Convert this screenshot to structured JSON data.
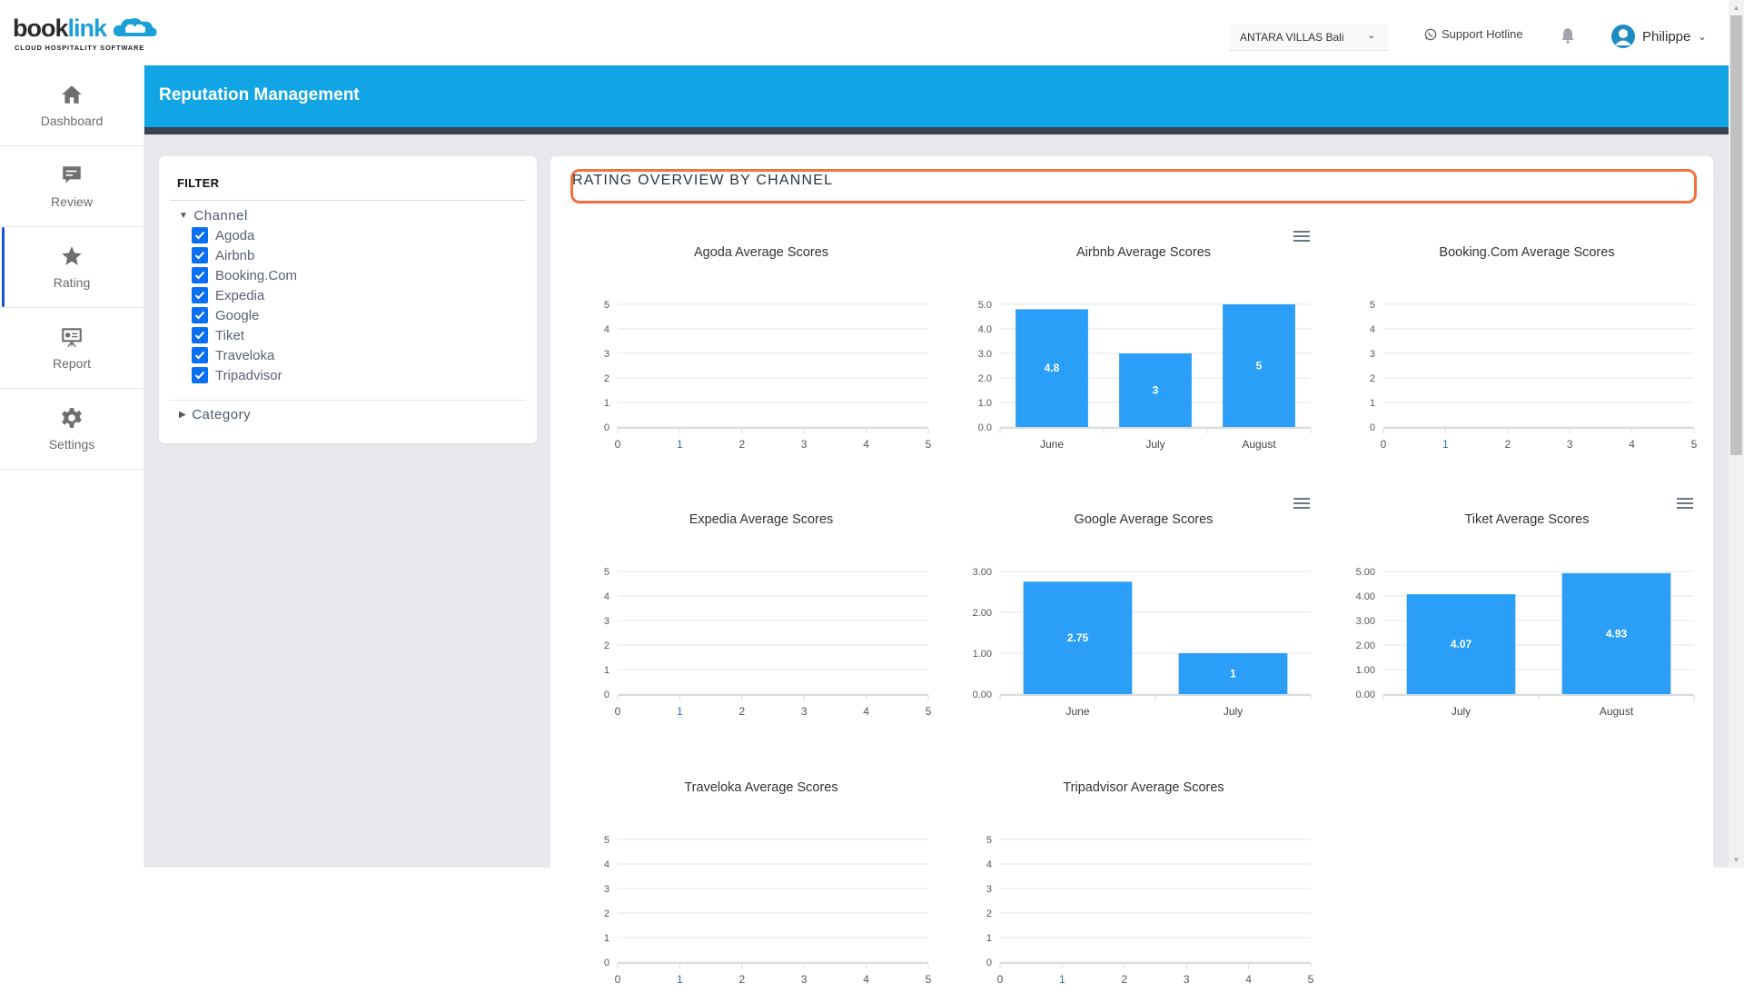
{
  "brand": {
    "logo_word_1": "book",
    "logo_word_2": "link",
    "tagline": "CLOUD HOSPITALITY SOFTWARE",
    "accent_color": "#12a5e5",
    "bar_color": "#2b9ff7",
    "highlight_color": "#f5703c"
  },
  "header": {
    "hotel_select_value": "ANTARA VILLAS Bali",
    "support_label": "Support Hotline",
    "user_name": "Philippe"
  },
  "sidebar": {
    "items": [
      {
        "label": "Dashboard",
        "icon": "home-icon",
        "active": false
      },
      {
        "label": "Review",
        "icon": "comment-icon",
        "active": false
      },
      {
        "label": "Rating",
        "icon": "star-icon",
        "active": true
      },
      {
        "label": "Report",
        "icon": "presentation-icon",
        "active": false
      },
      {
        "label": "Settings",
        "icon": "gear-icon",
        "active": false
      }
    ]
  },
  "page": {
    "title": "Reputation Management"
  },
  "filter": {
    "title": "FILTER",
    "channel_label": "Channel",
    "channel_expanded": true,
    "channels": [
      {
        "label": "Agoda",
        "checked": true
      },
      {
        "label": "Airbnb",
        "checked": true
      },
      {
        "label": "Booking.Com",
        "checked": true
      },
      {
        "label": "Expedia",
        "checked": true
      },
      {
        "label": "Google",
        "checked": true
      },
      {
        "label": "Tiket",
        "checked": true
      },
      {
        "label": "Traveloka",
        "checked": true
      },
      {
        "label": "Tripadvisor",
        "checked": true
      }
    ],
    "category_label": "Category",
    "category_expanded": false
  },
  "overview": {
    "title": "RATING OVERVIEW BY CHANNEL"
  },
  "chart_data": [
    {
      "type": "bar",
      "title": "Agoda Average Scores",
      "categories": [],
      "values": [],
      "empty": true,
      "yticks": [
        "0",
        "1",
        "2",
        "3",
        "4",
        "5"
      ],
      "xticks": [
        "0",
        "1",
        "2",
        "3",
        "4",
        "5"
      ],
      "ylim": [
        0,
        5
      ],
      "grid": true,
      "has_menu": false
    },
    {
      "type": "bar",
      "title": "Airbnb Average Scores",
      "categories": [
        "June",
        "July",
        "August"
      ],
      "values": [
        4.8,
        3,
        5
      ],
      "data_labels": [
        "4.8",
        "3",
        "5"
      ],
      "yticks": [
        "0.0",
        "1.0",
        "2.0",
        "3.0",
        "4.0",
        "5.0"
      ],
      "ylim": [
        0,
        5
      ],
      "grid": true,
      "has_menu": true
    },
    {
      "type": "bar",
      "title": "Booking.Com Average Scores",
      "categories": [],
      "values": [],
      "empty": true,
      "yticks": [
        "0",
        "1",
        "2",
        "3",
        "4",
        "5"
      ],
      "xticks": [
        "0",
        "1",
        "2",
        "3",
        "4",
        "5"
      ],
      "ylim": [
        0,
        5
      ],
      "grid": true,
      "has_menu": false
    },
    {
      "type": "bar",
      "title": "Expedia Average Scores",
      "categories": [],
      "values": [],
      "empty": true,
      "yticks": [
        "0",
        "1",
        "2",
        "3",
        "4",
        "5"
      ],
      "xticks": [
        "0",
        "1",
        "2",
        "3",
        "4",
        "5"
      ],
      "ylim": [
        0,
        5
      ],
      "grid": true,
      "has_menu": false
    },
    {
      "type": "bar",
      "title": "Google Average Scores",
      "categories": [
        "June",
        "July"
      ],
      "values": [
        2.75,
        1
      ],
      "data_labels": [
        "2.75",
        "1"
      ],
      "yticks": [
        "0.00",
        "1.00",
        "2.00",
        "3.00"
      ],
      "ylim": [
        0,
        3
      ],
      "grid": true,
      "has_menu": true
    },
    {
      "type": "bar",
      "title": "Tiket Average Scores",
      "categories": [
        "July",
        "August"
      ],
      "values": [
        4.07,
        4.93
      ],
      "data_labels": [
        "4.07",
        "4.93"
      ],
      "yticks": [
        "0.00",
        "1.00",
        "2.00",
        "3.00",
        "4.00",
        "5.00"
      ],
      "ylim": [
        0,
        5
      ],
      "grid": true,
      "has_menu": true
    },
    {
      "type": "bar",
      "title": "Traveloka Average Scores",
      "categories": [],
      "values": [],
      "empty": true,
      "yticks": [
        "0",
        "1",
        "2",
        "3",
        "4",
        "5"
      ],
      "xticks": [
        "0",
        "1",
        "2",
        "3",
        "4",
        "5"
      ],
      "ylim": [
        0,
        5
      ],
      "grid": true,
      "has_menu": false
    },
    {
      "type": "bar",
      "title": "Tripadvisor Average Scores",
      "categories": [],
      "values": [],
      "empty": true,
      "yticks": [
        "0",
        "1",
        "2",
        "3",
        "4",
        "5"
      ],
      "xticks": [
        "0",
        "1",
        "2",
        "3",
        "4",
        "5"
      ],
      "ylim": [
        0,
        5
      ],
      "grid": true,
      "has_menu": false
    }
  ]
}
